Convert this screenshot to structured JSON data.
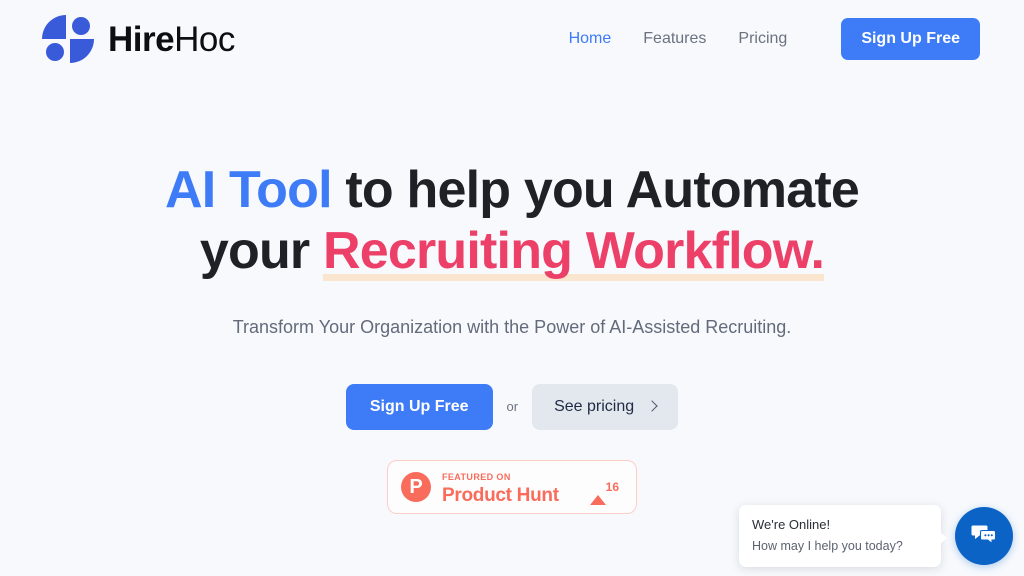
{
  "brand": {
    "name_strong": "Hire",
    "name_light": "Hoc",
    "logo_icon": "hirehoc-circle-quadrants-logo"
  },
  "nav": {
    "links": [
      {
        "label": "Home",
        "active": true
      },
      {
        "label": "Features",
        "active": false
      },
      {
        "label": "Pricing",
        "active": false
      }
    ],
    "cta_label": "Sign Up Free"
  },
  "hero": {
    "headline": {
      "part1": "AI Tool",
      "part2": " to help you Automate your ",
      "part3": "Recruiting Workflow."
    },
    "subtitle": "Transform Your Organization with the Power of AI-Assisted Recruiting.",
    "primary_cta": "Sign Up Free",
    "or_label": "or",
    "secondary_cta": "See pricing",
    "secondary_cta_icon": "chevron-right-icon"
  },
  "product_hunt": {
    "logo_letter": "P",
    "featured_label": "FEATURED ON",
    "name": "Product Hunt",
    "upvote_icon": "upvote-triangle-icon",
    "upvote_count": "16"
  },
  "chat": {
    "status_title": "We're Online!",
    "prompt": "How may I help you today?",
    "fab_icon": "chat-bubbles-icon"
  },
  "colors": {
    "page_background": "#f7f9fd",
    "brand_blue": "#3d7bf7",
    "accent_pink": "#ec4069",
    "highlight_underline": "#fae5cf",
    "product_hunt_coral": "#f96c5b",
    "chat_blue": "#0b63c5",
    "secondary_button": "#e3e7ee"
  }
}
